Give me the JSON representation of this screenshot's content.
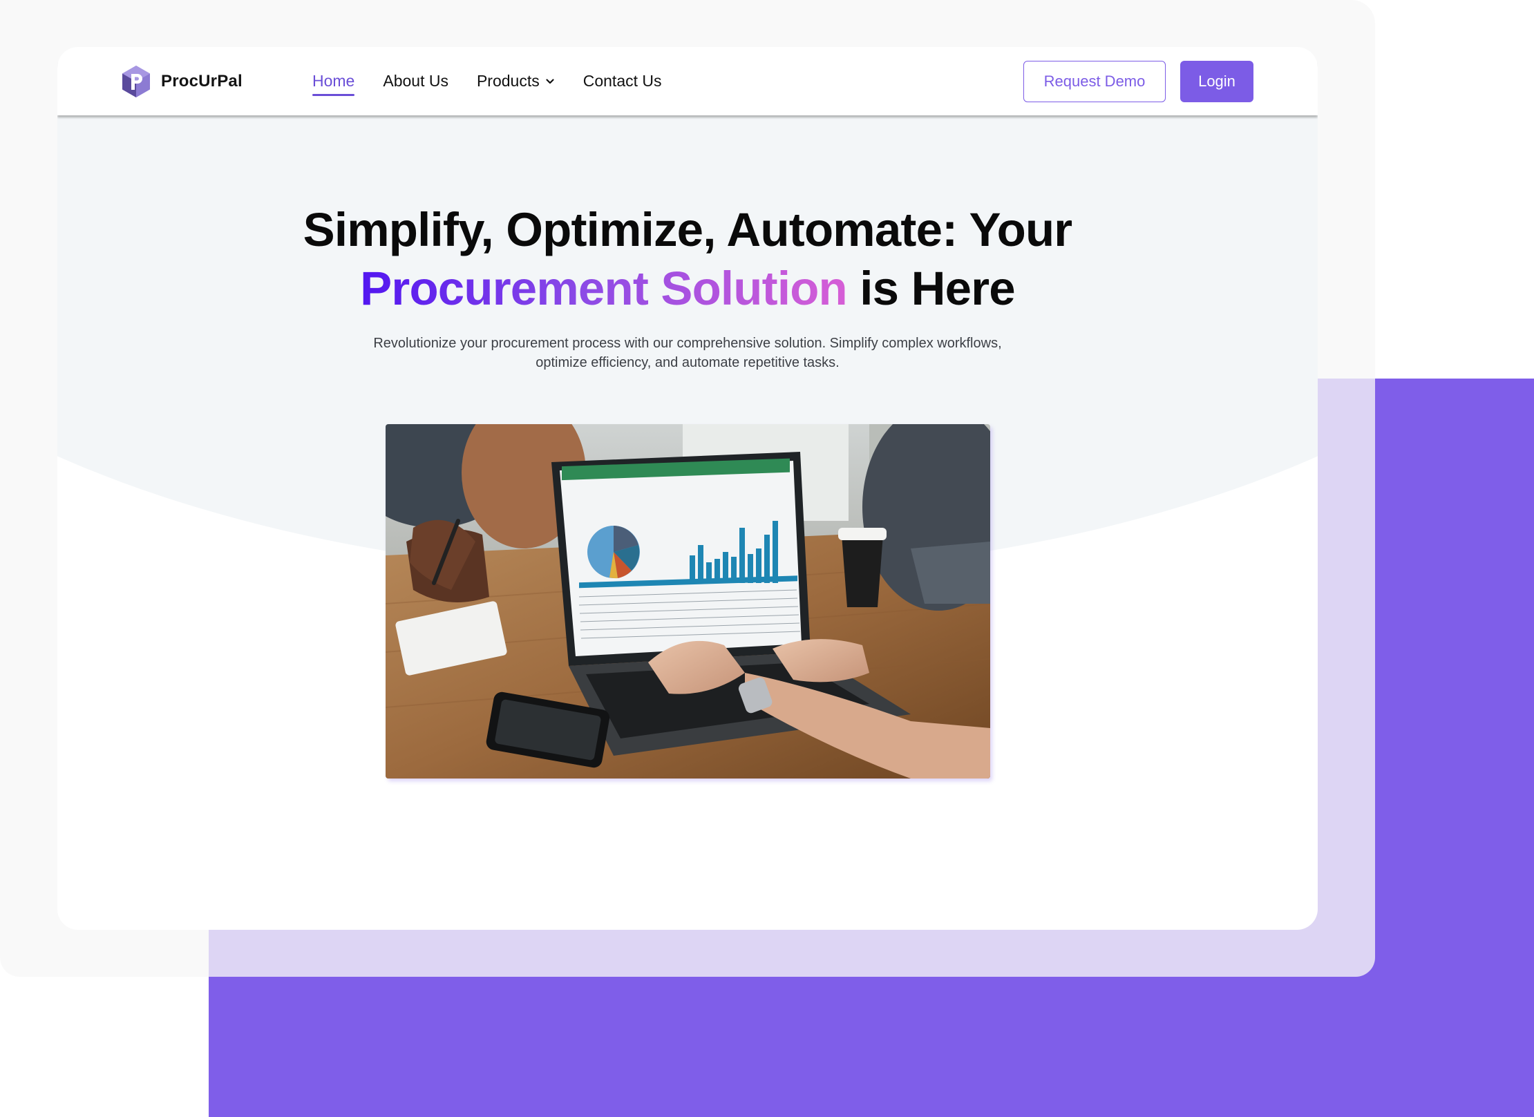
{
  "brand": {
    "name": "ProcUrPal",
    "logo_icon": "hexagon-p-logo-icon",
    "accent_color": "#7c5ce6"
  },
  "nav": {
    "items": [
      {
        "label": "Home",
        "active": true
      },
      {
        "label": "About Us"
      },
      {
        "label": "Products",
        "icon": "chevron-down-icon"
      },
      {
        "label": "Contact Us"
      }
    ],
    "request_demo_label": "Request Demo",
    "login_label": "Login"
  },
  "hero": {
    "title_line1": "Simplify, Optimize, Automate: Your",
    "title_highlight": "Procurement Solution",
    "title_tail": " is Here",
    "subtitle": "Revolutionize your procurement process with our comprehensive solution. Simplify complex workflows, optimize efficiency, and automate repetitive tasks.",
    "image_alt": "people working on a laptop showing a spreadsheet with pie and bar charts"
  }
}
